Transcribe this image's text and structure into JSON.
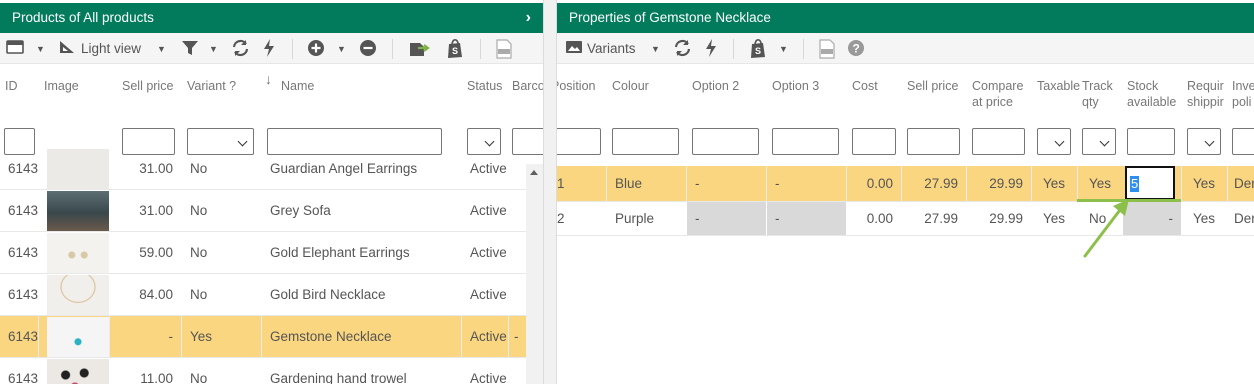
{
  "left_panel": {
    "title": "Products of All products",
    "toolbar": {
      "view_label": "Light view"
    },
    "columns": {
      "id": "ID",
      "image": "Image",
      "sell_price": "Sell price",
      "variant": "Variant ?",
      "sort_arrow": "↓",
      "name": "Name",
      "status": "Status",
      "barcode": "Barco"
    },
    "rows": [
      {
        "id": "6143",
        "sell_price": "31.00",
        "variant": "No",
        "name": "Guardian Angel Earrings",
        "status": "Active",
        "extra": ""
      },
      {
        "id": "6143",
        "sell_price": "31.00",
        "variant": "No",
        "name": "Grey Sofa",
        "status": "Active",
        "extra": ""
      },
      {
        "id": "6143",
        "sell_price": "59.00",
        "variant": "No",
        "name": "Gold Elephant Earrings",
        "status": "Active",
        "extra": ""
      },
      {
        "id": "6143",
        "sell_price": "84.00",
        "variant": "No",
        "name": "Gold Bird Necklace",
        "status": "Active",
        "extra": ""
      },
      {
        "id": "6143",
        "sell_price": "-",
        "variant": "Yes",
        "name": "Gemstone Necklace",
        "status": "Active",
        "extra": "-"
      },
      {
        "id": "6143",
        "sell_price": "11.00",
        "variant": "No",
        "name": "Gardening hand trowel",
        "status": "Active",
        "extra": ""
      }
    ]
  },
  "right_panel": {
    "title": "Properties of Gemstone Necklace",
    "toolbar": {
      "view_label": "Variants"
    },
    "columns": {
      "position": "Position",
      "colour": "Colour",
      "option2": "Option 2",
      "option3": "Option 3",
      "cost": "Cost",
      "sell_price": "Sell price",
      "compare_l1": "Compare",
      "compare_l2": "at price",
      "taxable": "Taxable",
      "track_l1": "Track",
      "track_l2": "qty",
      "stock_l1": "Stock",
      "stock_l2": "available",
      "req_l1": "Requir",
      "req_l2": "shippir",
      "inv_l1": "Inve",
      "inv_l2": "poli"
    },
    "rows": [
      {
        "position": "1",
        "colour": "Blue",
        "option2": "-",
        "option3": "-",
        "cost": "0.00",
        "sell_price": "27.99",
        "compare": "29.99",
        "taxable": "Yes",
        "track": "Yes",
        "stock": "5",
        "requires": "Yes",
        "inventory": "Der"
      },
      {
        "position": "2",
        "colour": "Purple",
        "option2": "-",
        "option3": "-",
        "cost": "0.00",
        "sell_price": "27.99",
        "compare": "29.99",
        "taxable": "Yes",
        "track": "No",
        "stock": "-",
        "requires": "Yes",
        "inventory": "Der"
      }
    ]
  },
  "colors": {
    "header_green": "#017b5c",
    "selected_row": "#fbd680",
    "arrow_green": "#8dc04a"
  },
  "icons": [
    "table-view-icon",
    "tree-view-icon",
    "filter-icon",
    "refresh-icon",
    "lightning-icon",
    "add-icon",
    "remove-icon",
    "export-icon",
    "shopify-icon",
    "csv-icon",
    "help-icon"
  ]
}
